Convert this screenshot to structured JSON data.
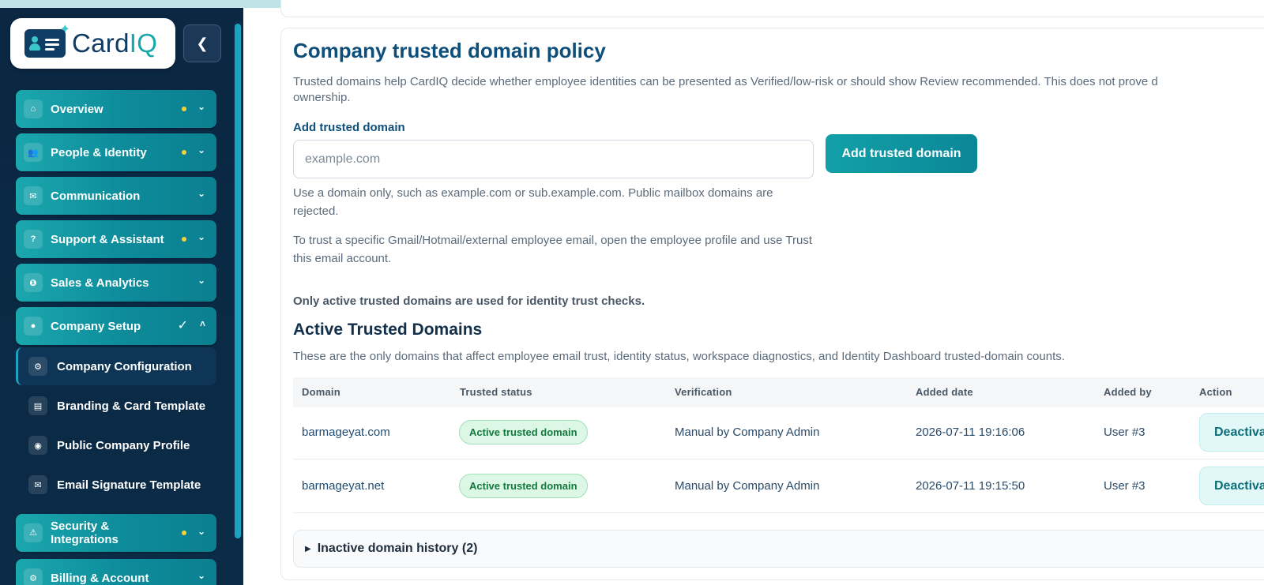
{
  "brand": {
    "name_main": "Card",
    "name_accent": "IQ",
    "collapse_glyph": "❮"
  },
  "sidebar": {
    "items": [
      {
        "label": "Overview",
        "icon": "home-icon",
        "glyph": "⌂",
        "has_dot": true,
        "chevron": "⌄"
      },
      {
        "label": "People & Identity",
        "icon": "people-icon",
        "glyph": "👥",
        "has_dot": true,
        "chevron": "⌄"
      },
      {
        "label": "Communication",
        "icon": "mail-icon",
        "glyph": "✉",
        "has_dot": false,
        "chevron": "⌄"
      },
      {
        "label": "Support & Assistant",
        "icon": "help-icon",
        "glyph": "?",
        "has_dot": true,
        "chevron": "⌄"
      },
      {
        "label": "Sales & Analytics",
        "icon": "chart-icon",
        "glyph": "❶",
        "has_dot": false,
        "chevron": "⌄"
      },
      {
        "label": "Company Setup",
        "icon": "company-icon",
        "glyph": "●",
        "check": "✓",
        "chevron": "˄"
      },
      {
        "label": "Security & Integrations",
        "label_line1": "Security &",
        "label_line2": "Integrations",
        "icon": "warning-icon",
        "glyph": "⚠",
        "has_dot": true,
        "chevron": "⌄"
      },
      {
        "label": "Billing & Account",
        "icon": "billing-icon",
        "glyph": "⚙",
        "chevron": "⌄"
      }
    ],
    "sub_items": [
      {
        "label": "Company Configuration",
        "icon": "gear-icon",
        "glyph": "⚙",
        "active": true
      },
      {
        "label": "Branding & Card Template",
        "icon": "card-template-icon",
        "glyph": "▤"
      },
      {
        "label": "Public Company Profile",
        "icon": "globe-icon",
        "glyph": "◉"
      },
      {
        "label": "Email Signature Template",
        "icon": "mail-icon",
        "glyph": "✉"
      }
    ]
  },
  "policy": {
    "title": "Company trusted domain policy",
    "description_line1": "Trusted domains help CardIQ decide whether employee identities can be presented as Verified/low-risk or should show Review recommended. This does not prove d",
    "description_line2": "ownership.",
    "add_label": "Add trusted domain",
    "input_placeholder": "example.com",
    "add_button": "Add trusted domain",
    "help1": "Use a domain only, such as example.com or sub.example.com. Public mailbox domains are rejected.",
    "help2": "To trust a specific Gmail/Hotmail/external employee email, open the employee profile and use Trust this email account.",
    "note": "Only active trusted domains are used for identity trust checks."
  },
  "active_domains": {
    "title": "Active Trusted Domains",
    "description": "These are the only domains that affect employee email trust, identity status, workspace diagnostics, and Identity Dashboard trusted-domain counts.",
    "columns": [
      "Domain",
      "Trusted status",
      "Verification",
      "Added date",
      "Added by",
      "Action"
    ],
    "rows": [
      {
        "domain": "barmageyat.com",
        "status": "Active trusted domain",
        "verification": "Manual by Company Admin",
        "added_date": "2026-07-11 19:16:06",
        "added_by": "User #3",
        "action": "Deactiva"
      },
      {
        "domain": "barmageyat.net",
        "status": "Active trusted domain",
        "verification": "Manual by Company Admin",
        "added_date": "2026-07-11 19:15:50",
        "added_by": "User #3",
        "action": "Deactiva"
      }
    ]
  },
  "inactive": {
    "label": "Inactive domain history (2)",
    "toggle_glyph": "▶"
  }
}
